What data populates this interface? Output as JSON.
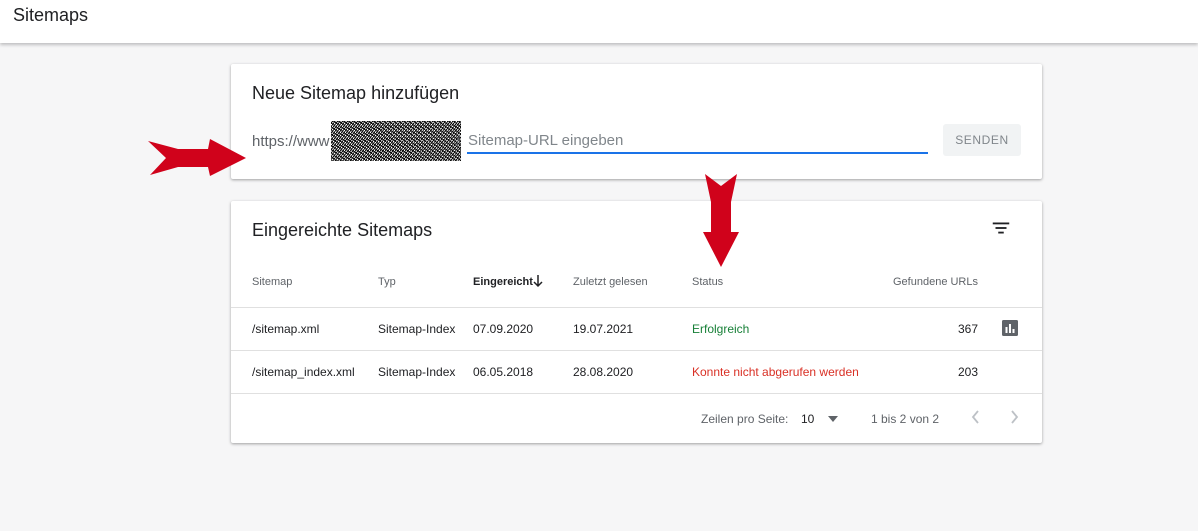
{
  "header": {
    "title": "Sitemaps"
  },
  "add_card": {
    "title": "Neue Sitemap hinzufügen",
    "url_prefix": "https://www",
    "slash": "/",
    "input_placeholder": "Sitemap-URL eingeben",
    "input_value": "",
    "send_label": "SENDEN"
  },
  "list_card": {
    "title": "Eingereichte Sitemaps",
    "columns": {
      "sitemap": "Sitemap",
      "type": "Typ",
      "submitted": "Eingereicht",
      "last_read": "Zuletzt gelesen",
      "status": "Status",
      "urls": "Gefundene URLs"
    },
    "rows": [
      {
        "sitemap": "/sitemap.xml",
        "type": "Sitemap-Index",
        "submitted": "07.09.2020",
        "last_read": "19.07.2021",
        "status": "Erfolgreich",
        "urls": "367"
      },
      {
        "sitemap": "/sitemap_index.xml",
        "type": "Sitemap-Index",
        "submitted": "06.05.2018",
        "last_read": "28.08.2020",
        "status": "Konnte nicht abgerufen werden",
        "urls": "203"
      }
    ],
    "pagination": {
      "rows_per_page_label": "Zeilen pro Seite:",
      "rows_per_page_value": "10",
      "range": "1 bis 2 von 2"
    }
  },
  "colors": {
    "accent": "#1a73e8",
    "success": "#188038",
    "error": "#d93025",
    "annotation_arrow": "#d0021b"
  },
  "icons": [
    "filter-icon",
    "sort-arrow-down-icon",
    "bar-chart-icon",
    "caret-down-icon",
    "chevron-left-icon",
    "chevron-right-icon",
    "red-arrow-right-icon",
    "red-arrow-down-icon"
  ]
}
